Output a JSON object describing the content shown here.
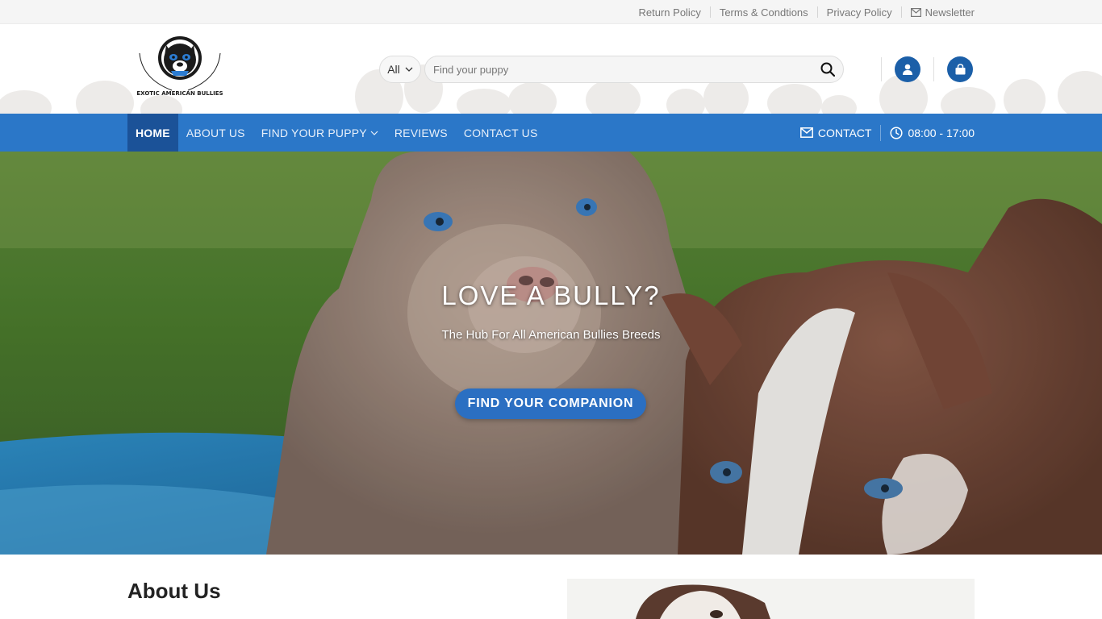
{
  "topbar": {
    "links": [
      {
        "label": "Return Policy"
      },
      {
        "label": "Terms & Condtions"
      },
      {
        "label": "Privacy Policy"
      },
      {
        "label": "Newsletter",
        "icon": "envelope-icon"
      }
    ]
  },
  "header": {
    "logo_text": "EXOTIC AMERICAN BULLIES",
    "search": {
      "category": "All",
      "placeholder": "Find your puppy"
    },
    "icons": [
      "user-icon",
      "bag-icon"
    ]
  },
  "nav": {
    "items": [
      {
        "label": "HOME",
        "active": true
      },
      {
        "label": "ABOUT US"
      },
      {
        "label": "FIND YOUR PUPPY",
        "has_dropdown": true
      },
      {
        "label": "REVIEWS"
      },
      {
        "label": "CONTACT US"
      }
    ],
    "contact_label": "CONTACT",
    "hours": "08:00 - 17:00"
  },
  "hero": {
    "title": "LOVE A BULLY?",
    "subtitle": "The Hub For All American Bullies Breeds",
    "cta": "FIND YOUR COMPANION"
  },
  "about": {
    "title": "About Us"
  },
  "colors": {
    "primary_blue": "#2b77c8",
    "active_nav": "#1b5298",
    "icon_blue": "#1b5fa8",
    "topbar_bg": "#f5f5f5"
  }
}
